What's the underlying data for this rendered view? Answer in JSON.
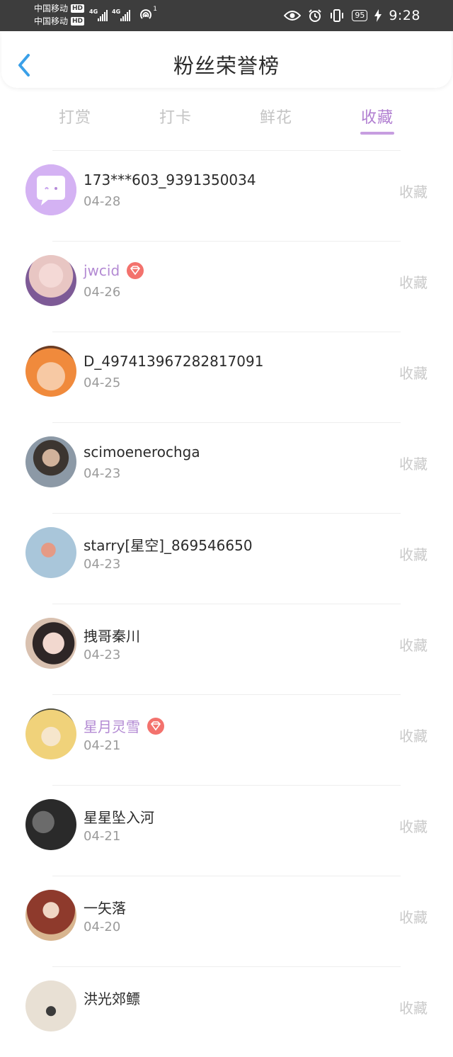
{
  "status_bar": {
    "carrier1": "中国移动",
    "carrier2": "中国移动",
    "hd1": "HD",
    "hd2": "HD",
    "signal1_tag": "4G",
    "signal2_tag": "4G",
    "wifi_sup": "1",
    "battery": "95",
    "time": "9:28"
  },
  "header": {
    "title": "粉丝荣誉榜"
  },
  "tabs": [
    {
      "label": "打赏"
    },
    {
      "label": "打卡"
    },
    {
      "label": "鲜花"
    },
    {
      "label": "收藏"
    }
  ],
  "active_tab": "收藏",
  "fans": [
    {
      "name": "173***603_9391350034",
      "date": "04-28",
      "action": "收藏",
      "vip": false
    },
    {
      "name": "jwcid",
      "date": "04-26",
      "action": "收藏",
      "vip": true
    },
    {
      "name": "D_497413967282817091",
      "date": "04-25",
      "action": "收藏",
      "vip": false
    },
    {
      "name": "scimoenerochga",
      "date": "04-23",
      "action": "收藏",
      "vip": false
    },
    {
      "name": "starry[星空]_869546650",
      "date": "04-23",
      "action": "收藏",
      "vip": false
    },
    {
      "name": "拽哥秦川",
      "date": "04-23",
      "action": "收藏",
      "vip": false
    },
    {
      "name": "星月灵雪",
      "date": "04-21",
      "action": "收藏",
      "vip": true
    },
    {
      "name": "星星坠入河",
      "date": "04-21",
      "action": "收藏",
      "vip": false
    },
    {
      "name": "一矢落",
      "date": "04-20",
      "action": "收藏",
      "vip": false
    },
    {
      "name": "洪光郊鳔",
      "date": "",
      "action": "收藏",
      "vip": false
    }
  ],
  "colors": {
    "accent": "#b17fd1",
    "vip_badge": "#f3726d",
    "back_arrow": "#3aa0e8"
  },
  "icons": {
    "back": "chevron-left-icon",
    "vip": "diamond-icon",
    "eye": "eye-icon",
    "alarm": "alarm-icon",
    "vibrate": "vibrate-icon",
    "bolt": "charging-icon"
  }
}
